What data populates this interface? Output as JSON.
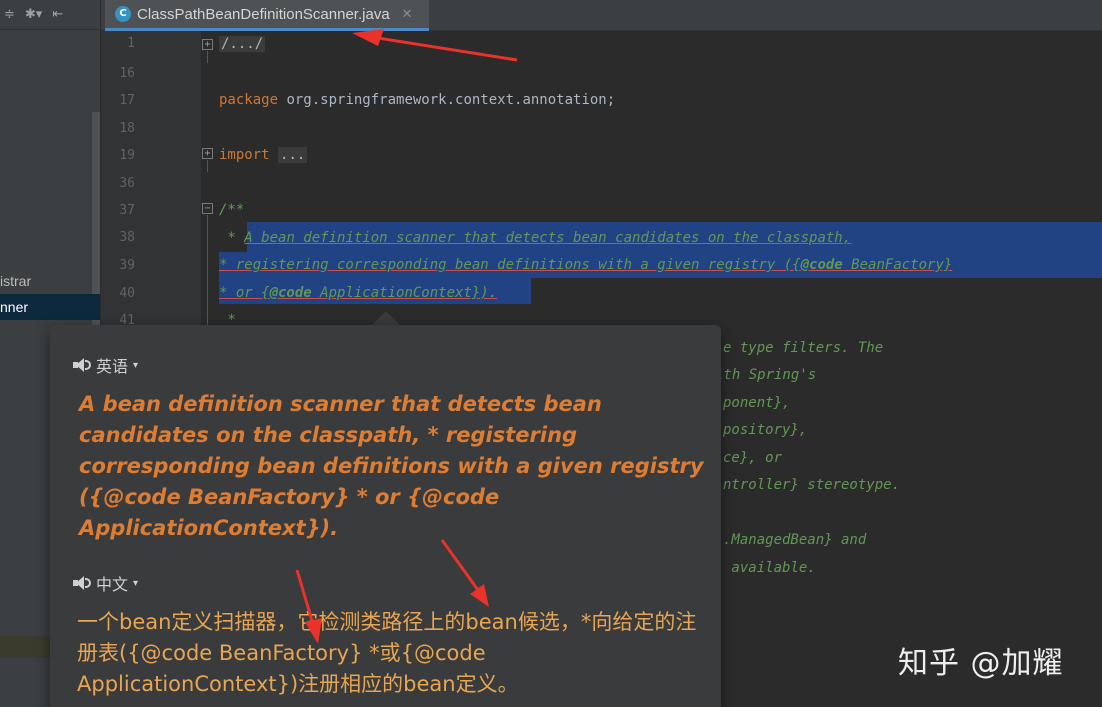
{
  "tab": {
    "icon": "C",
    "title": "ClassPathBeanDefinitionScanner.java",
    "close": "✕"
  },
  "sidebar": {
    "toolbar": {
      "collapse_icon": "≑",
      "settings_icon": "✱▾",
      "pin_icon": "⇤"
    },
    "items": [
      {
        "label": "istrar"
      },
      {
        "label": "nner"
      }
    ]
  },
  "editor": {
    "line_numbers": [
      "1",
      "16",
      "17",
      "18",
      "19",
      "36",
      "37",
      "38",
      "39",
      "40",
      "41"
    ],
    "lines": {
      "l1": "/.../",
      "l17_kw": "package",
      "l17_rest": " org.springframework.context.annotation;",
      "l19_kw": "import",
      "l19_folded": "...",
      "l37": "/**",
      "l38_star": " * ",
      "l38_text": "A bean definition scanner that detects bean candidates on the classpath,",
      "l39_a": "* registering corresponding bean definitions with a given registry ({",
      "l39_tag": "@code",
      "l39_b": " BeanFactory}",
      "l40_a": "* or {",
      "l40_tag": "@code",
      "l40_b": " ApplicationContext}).",
      "l41": " *"
    },
    "right_fragments": [
      "e type filters. The",
      "ith Spring's",
      "ponent},",
      "pository},",
      "ce}, or",
      "ntroller} stereotype.",
      ".ManagedBean} and",
      " available."
    ]
  },
  "popup": {
    "source_lang": "英语",
    "source_text": "A bean definition scanner that detects bean candidates on the classpath, * registering corresponding bean definitions with a given registry ({@code BeanFactory} * or {@code ApplicationContext}).",
    "target_lang": "中文",
    "target_text": "一个bean定义扫描器，它检测类路径上的bean候选，*向给定的注册表({@code BeanFactory} *或{@code ApplicationContext})注册相应的bean定义。",
    "lang_caret": "▾"
  },
  "watermark": "知乎 @加耀",
  "colors": {
    "editor_bg": "#2b2b2b",
    "keyword": "#cc7832",
    "doc_comment": "#629755",
    "selection": "#214283",
    "translation_source": "#dd7d34",
    "translation_target": "#e8a552",
    "arrow": "#e8322a"
  }
}
